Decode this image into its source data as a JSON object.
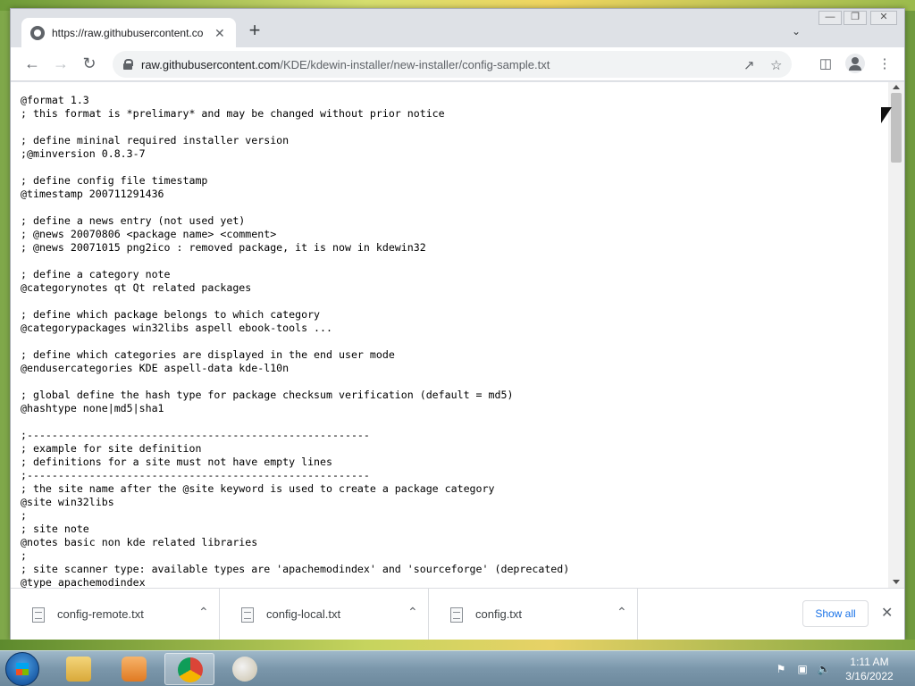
{
  "browser": {
    "tab": {
      "title": "https://raw.githubusercontent.co",
      "close": "✕"
    },
    "new_tab": "+",
    "address": {
      "host": "raw.githubusercontent.com",
      "path": "/KDE/kdewin-installer/new-installer/config-sample.txt"
    }
  },
  "document": {
    "lines": [
      "@format 1.3",
      "; this format is *prelimary* and may be changed without prior notice",
      "",
      "; define mininal required installer version",
      ";@minversion 0.8.3-7",
      "",
      "; define config file timestamp",
      "@timestamp 200711291436",
      "",
      "; define a news entry (not used yet)",
      "; @news 20070806 <package name> <comment>",
      "; @news 20071015 png2ico : removed package, it is now in kdewin32",
      "",
      "; define a category note",
      "@categorynotes qt Qt related packages",
      "",
      "; define which package belongs to which category",
      "@categorypackages win32libs aspell ebook-tools ...",
      "",
      "; define which categories are displayed in the end user mode",
      "@endusercategories KDE aspell-data kde-l10n",
      "",
      "; global define the hash type for package checksum verification (default = md5)",
      "@hashtype none|md5|sha1",
      "",
      ";-------------------------------------------------------",
      "; example for site definition",
      "; definitions for a site must not have empty lines",
      ";-------------------------------------------------------",
      "; the site name after the @site keyword is used to create a package category",
      "@site win32libs",
      ";",
      "; site note",
      "@notes basic non kde related libraries",
      ";",
      "; site scanner type: available types are 'apachemodindex' and 'sourceforge' (deprecated)",
      "@type apachemodindex"
    ]
  },
  "downloads": {
    "items": [
      {
        "name": "config-remote.txt"
      },
      {
        "name": "config-local.txt"
      },
      {
        "name": "config.txt"
      }
    ],
    "show_all": "Show all"
  },
  "taskbar": {
    "clock_time": "1:11 AM",
    "clock_date": "3/16/2022"
  }
}
